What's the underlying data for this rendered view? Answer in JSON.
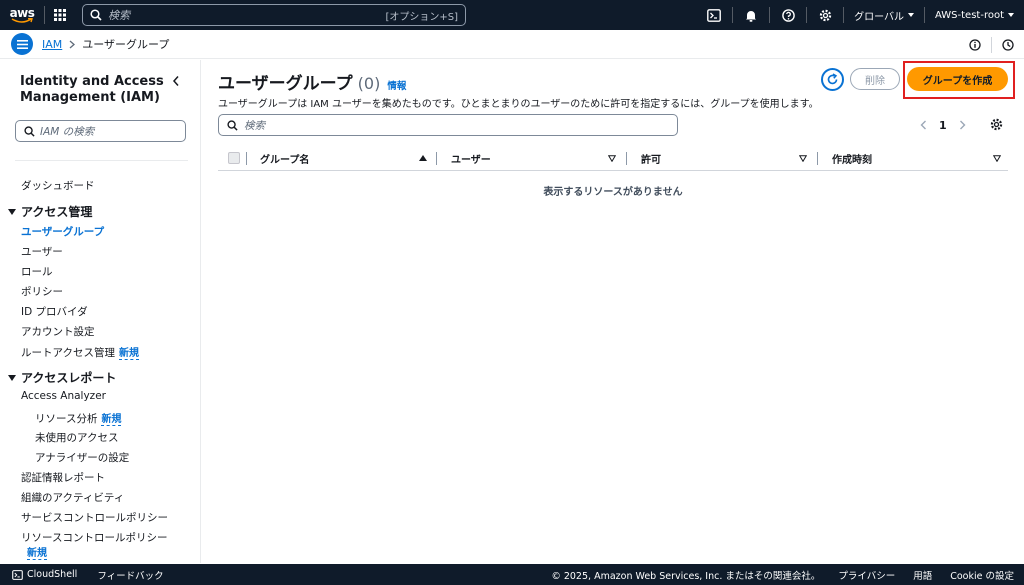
{
  "topnav": {
    "logo": "aws",
    "search_placeholder": "検索",
    "search_shortcut": "[オプション+S]",
    "region": "グローバル",
    "account": "AWS-test-root",
    "icons": [
      "cloudshell-icon",
      "bell-icon",
      "help-icon",
      "gear-icon"
    ]
  },
  "breadcrumb": {
    "root": "IAM",
    "current": "ユーザーグループ"
  },
  "sidebar": {
    "title": "Identity and Access Management (IAM)",
    "search_placeholder": "IAM の検索",
    "dashboard": "ダッシュボード",
    "section_access_mgmt": "アクセス管理",
    "items_access": [
      {
        "label": "ユーザーグループ",
        "active": true
      },
      {
        "label": "ユーザー"
      },
      {
        "label": "ロール"
      },
      {
        "label": "ポリシー"
      },
      {
        "label": "ID プロバイダ"
      },
      {
        "label": "アカウント設定"
      },
      {
        "label": "ルートアクセス管理",
        "badge": "新規"
      }
    ],
    "section_access_reports": "アクセスレポート",
    "access_analyzer": "Access Analyzer",
    "analyzer_items": [
      {
        "label": "リソース分析",
        "badge": "新規"
      },
      {
        "label": "未使用のアクセス"
      },
      {
        "label": "アナライザーの設定"
      }
    ],
    "report_items": [
      {
        "label": "認証情報レポート"
      },
      {
        "label": "組織のアクティビティ"
      },
      {
        "label": "サービスコントロールポリシー"
      },
      {
        "label": "リソースコントロールポリシー",
        "badge": "新規"
      }
    ]
  },
  "main": {
    "title": "ユーザーグループ",
    "count": "(0)",
    "info": "情報",
    "description": "ユーザーグループは IAM ユーザーを集めたものです。ひとまとまりのユーザーのために許可を指定するには、グループを使用します。",
    "delete_label": "削除",
    "create_label": "グループを作成",
    "search_placeholder": "検索",
    "page_number": "1",
    "columns": [
      "グループ名",
      "ユーザー",
      "許可",
      "作成時刻"
    ],
    "empty_message": "表示するリソースがありません"
  },
  "footer": {
    "cloudshell": "CloudShell",
    "feedback": "フィードバック",
    "copyright": "© 2025, Amazon Web Services, Inc. またはその関連会社。",
    "privacy": "プライバシー",
    "terms": "用語",
    "cookie": "Cookie の設定"
  },
  "colors": {
    "nav_bg": "#0f1b2a",
    "link": "#0972d3",
    "primary_btn": "#ff9900",
    "highlight": "#e02020"
  }
}
